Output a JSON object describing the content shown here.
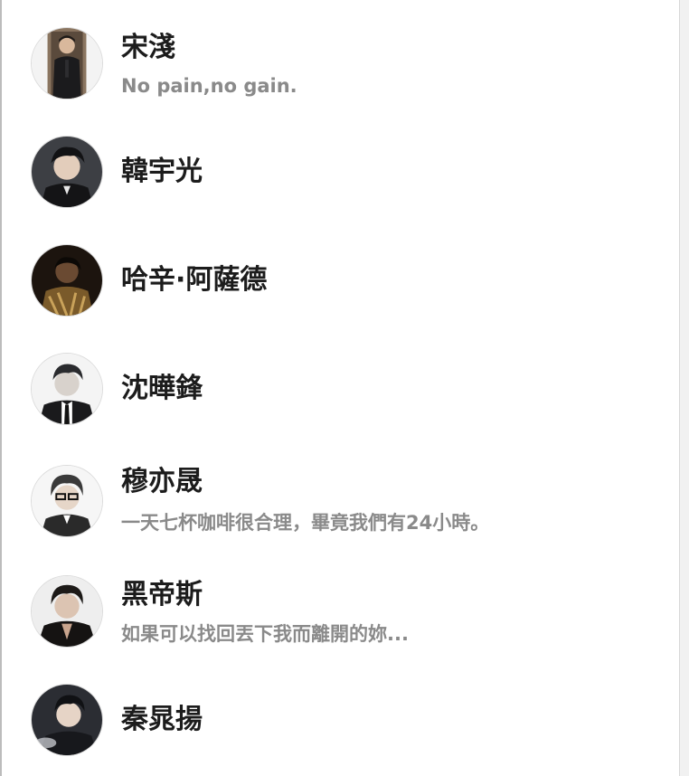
{
  "characters": [
    {
      "name": "宋淺",
      "subtitle": "No pain,no gain.",
      "avatar_icon": "character-avatar-1"
    },
    {
      "name": "韓宇光",
      "subtitle": "",
      "avatar_icon": "character-avatar-2"
    },
    {
      "name": "哈辛·阿薩德",
      "subtitle": "",
      "avatar_icon": "character-avatar-3"
    },
    {
      "name": "沈曄鋒",
      "subtitle": "",
      "avatar_icon": "character-avatar-4"
    },
    {
      "name": "穆亦晟",
      "subtitle": "一天七杯咖啡很合理，畢竟我們有24小時。",
      "avatar_icon": "character-avatar-5"
    },
    {
      "name": "黑帝斯",
      "subtitle": "如果可以找回丟下我而離開的妳...",
      "avatar_icon": "character-avatar-6"
    },
    {
      "name": "秦晁揚",
      "subtitle": "",
      "avatar_icon": "character-avatar-7"
    }
  ],
  "colors": {
    "name_text": "#1c1c1c",
    "subtitle_text": "#8a8a8a",
    "panel_bg": "#ffffff",
    "backdrop_accent": "#8d6bb0"
  }
}
